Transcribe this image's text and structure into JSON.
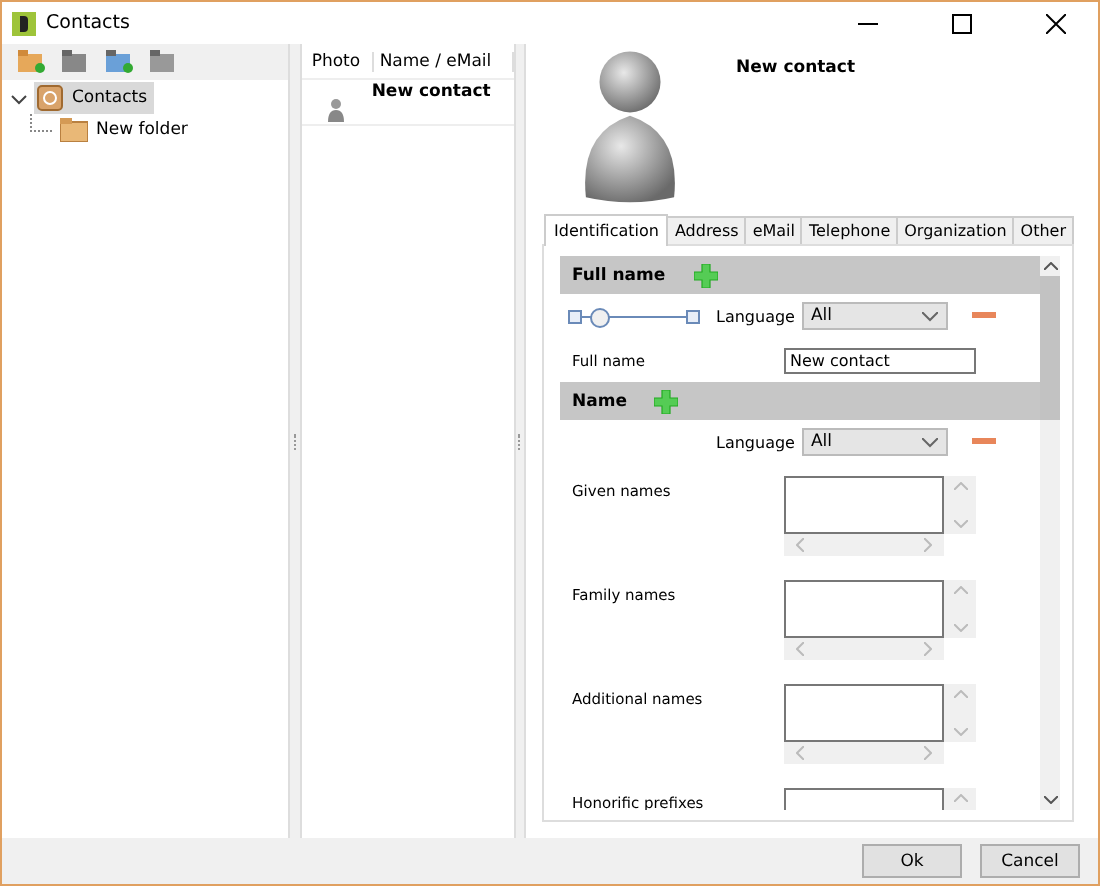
{
  "window": {
    "title": "Contacts"
  },
  "tree": [
    {
      "label": "Contacts",
      "selected": true,
      "expanded": true,
      "children": [
        {
          "label": "New folder",
          "selected": false
        }
      ]
    }
  ],
  "list": {
    "columns": [
      "Photo",
      "Name / eMail"
    ],
    "rows": [
      {
        "name": "New contact",
        "selected": false
      }
    ]
  },
  "contact": {
    "name": "New contact"
  },
  "tabs": [
    {
      "label": "Identification",
      "selected": true
    },
    {
      "label": "Address",
      "selected": false
    },
    {
      "label": "eMail",
      "selected": false
    },
    {
      "label": "Telephone",
      "selected": false
    },
    {
      "label": "Organization",
      "selected": false
    },
    {
      "label": "Other",
      "selected": false
    }
  ],
  "sections": [
    {
      "title": "Full name",
      "slider": {
        "level": 0.15
      },
      "language": {
        "label": "Language",
        "value": "All"
      },
      "fields": [
        {
          "kind": "line",
          "label": "Full name",
          "value": "New contact"
        }
      ]
    },
    {
      "title": "Name",
      "language": {
        "label": "Language",
        "value": "All"
      },
      "fields": [
        {
          "kind": "area",
          "label": "Given names"
        },
        {
          "kind": "area",
          "label": "Family names"
        },
        {
          "kind": "area",
          "label": "Additional names"
        },
        {
          "kind": "area",
          "label": "Honorific prefixes"
        }
      ]
    }
  ],
  "buttons": [
    "Ok",
    "Cancel"
  ]
}
